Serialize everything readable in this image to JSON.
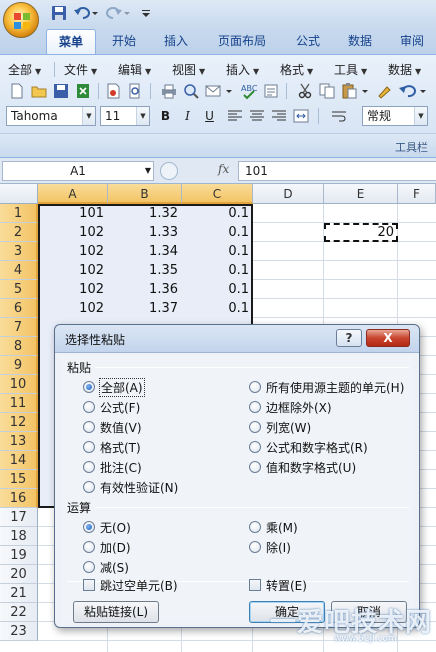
{
  "ribbon_tabs": [
    "菜单",
    "开始",
    "插入",
    "页面布局",
    "公式",
    "数据",
    "审阅"
  ],
  "active_tab": "菜单",
  "menus": [
    "全部",
    "文件",
    "编辑",
    "视图",
    "插入",
    "格式",
    "工具",
    "数据"
  ],
  "font": {
    "name": "Tahoma",
    "size": "11"
  },
  "format_buttons": {
    "bold": "B",
    "italic": "I",
    "underline": "U"
  },
  "number_format": "常规",
  "toolbar_label": "工具栏",
  "name_box": "A1",
  "fx_label": "fx",
  "formula_value": "101",
  "grid": {
    "columns": [
      "A",
      "B",
      "C",
      "D",
      "E",
      "F"
    ],
    "rows": [
      "1",
      "2",
      "3",
      "4",
      "5",
      "6",
      "7",
      "8",
      "9",
      "10",
      "11",
      "12",
      "13",
      "14",
      "15",
      "16",
      "17",
      "18",
      "19",
      "20",
      "21",
      "22",
      "23"
    ],
    "data_a": [
      "101",
      "102",
      "102",
      "102",
      "102",
      "102"
    ],
    "data_b": [
      "1.32",
      "1.33",
      "1.34",
      "1.35",
      "1.36",
      "1.37"
    ],
    "data_c": [
      "0.1",
      "0.1",
      "0.1",
      "0.1",
      "0.1",
      "0.1"
    ],
    "e2": "20"
  },
  "dialog": {
    "title": "选择性粘贴",
    "help": "?",
    "close": "X",
    "paste_label": "粘贴",
    "paste_left": [
      "全部(A)",
      "公式(F)",
      "数值(V)",
      "格式(T)",
      "批注(C)",
      "有效性验证(N)"
    ],
    "paste_right": [
      "所有使用源主题的单元(H)",
      "边框除外(X)",
      "列宽(W)",
      "公式和数字格式(R)",
      "值和数字格式(U)"
    ],
    "operation_label": "运算",
    "operation_left": [
      "无(O)",
      "加(D)",
      "减(S)"
    ],
    "operation_right": [
      "乘(M)",
      "除(I)"
    ],
    "skip_blanks": "跳过空单元(B)",
    "transpose": "转置(E)",
    "paste_link": "粘贴链接(L)",
    "ok": "确定",
    "cancel": "取消"
  },
  "watermark": {
    "text": "一爱吧技术网",
    "url": "www.52jl.com"
  }
}
